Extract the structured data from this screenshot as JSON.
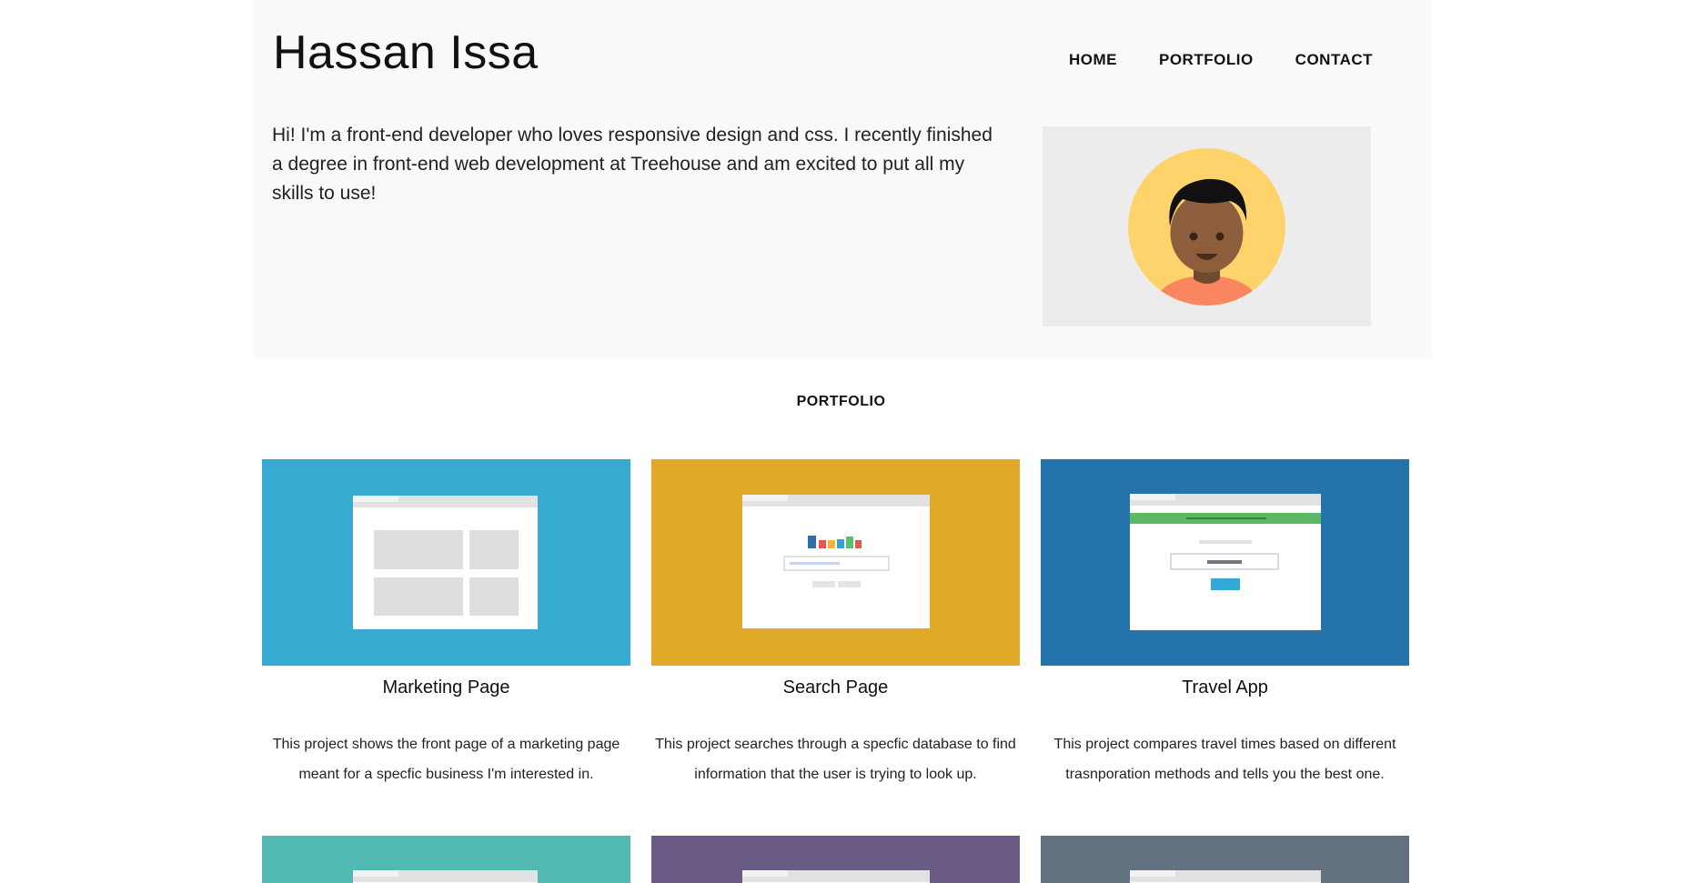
{
  "header": {
    "title": "Hassan Issa",
    "nav": [
      "HOME",
      "PORTFOLIO",
      "CONTACT"
    ]
  },
  "intro": {
    "text": "Hi! I'm a front-end developer who loves responsive design and css. I recently finished a degree in front-end web development at Treehouse and am excited to put all my skills to use!"
  },
  "portfolio": {
    "heading": "PORTFOLIO",
    "projects": [
      {
        "title": "Marketing Page",
        "description": "This project shows the front page of a marketing page meant for a specfic business I'm interested in.",
        "color": "#36aad1",
        "icon": "marketing-page-mockup-icon"
      },
      {
        "title": "Search Page",
        "description": "This project searches through a specfic database to find information that the user is trying to look up.",
        "color": "#e0aa28",
        "icon": "search-page-mockup-icon"
      },
      {
        "title": "Travel App",
        "description": "This project compares travel times based on different trasnporation methods and tells you the best one.",
        "color": "#2473ab",
        "icon": "travel-app-mockup-icon"
      }
    ],
    "more_projects": [
      {
        "color": "#52b9b2",
        "icon": "mockup-icon"
      },
      {
        "color": "#6a5a86",
        "icon": "mockup-icon"
      },
      {
        "color": "#637280",
        "icon": "mockup-icon"
      }
    ]
  },
  "colors": {
    "hero_bg": "#f9f9f9",
    "avatar_box_bg": "#ececec",
    "avatar_circle": "#ffd36b"
  }
}
